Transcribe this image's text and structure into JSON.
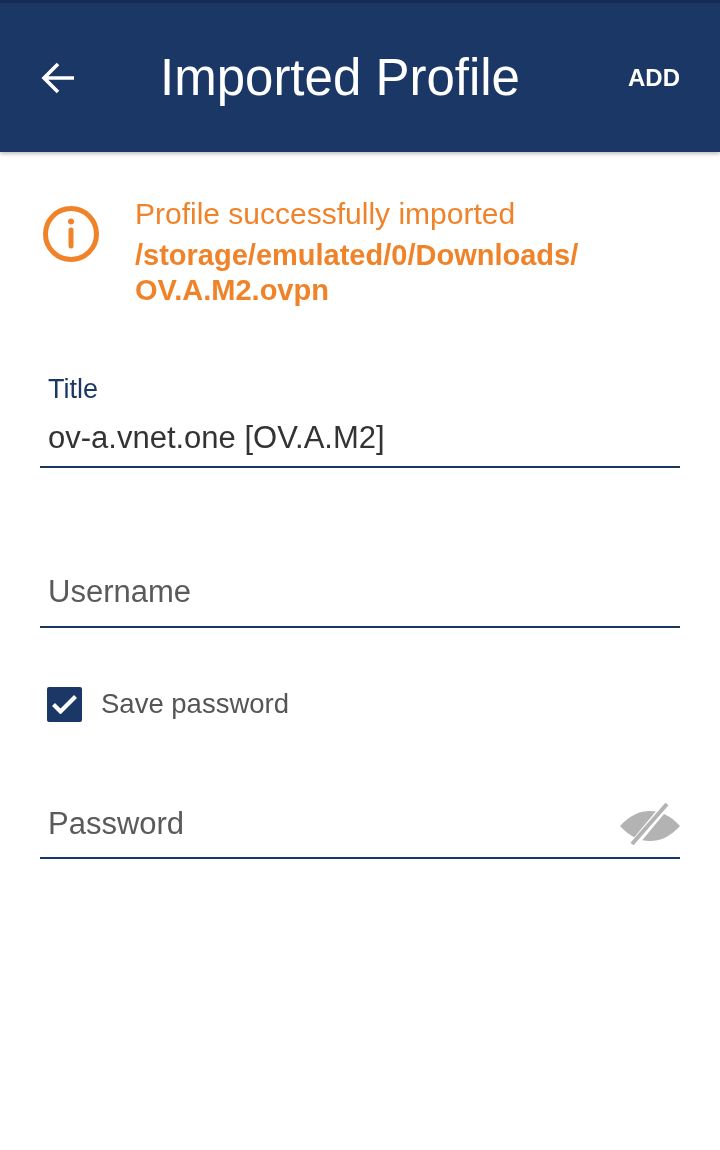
{
  "app_bar": {
    "title": "Imported Profile",
    "action": "ADD"
  },
  "notice": {
    "message": "Profile successfully imported",
    "path": "/storage/emulated/0/Downloads/OV.A.M2.ovpn"
  },
  "form": {
    "fields": [
      {
        "kind": "text",
        "label": "Title",
        "value": "ov-a.vnet.one [OV.A.M2]"
      },
      {
        "kind": "text",
        "placeholder": "Username"
      },
      {
        "kind": "checkbox",
        "label": "Save password",
        "checked": true
      },
      {
        "kind": "password",
        "placeholder": "Password",
        "visible": false
      }
    ]
  }
}
